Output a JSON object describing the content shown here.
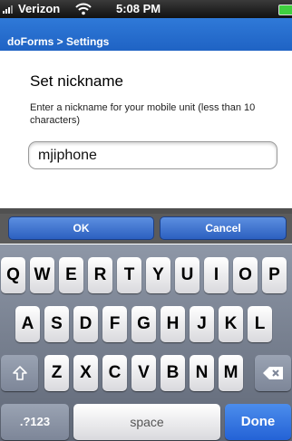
{
  "status_bar": {
    "carrier": "Verizon",
    "time": "5:08 PM"
  },
  "nav": {
    "title": "doForms > Settings"
  },
  "dialog": {
    "heading": "Set nickname",
    "description": "Enter a nickname for your mobile unit (less than 10 characters)",
    "nickname_value": "mjiphone"
  },
  "buttons": {
    "ok": "OK",
    "cancel": "Cancel"
  },
  "keyboard": {
    "row1": [
      "Q",
      "W",
      "E",
      "R",
      "T",
      "Y",
      "U",
      "I",
      "O",
      "P"
    ],
    "row2": [
      "A",
      "S",
      "D",
      "F",
      "G",
      "H",
      "J",
      "K",
      "L"
    ],
    "row3": [
      "Z",
      "X",
      "C",
      "V",
      "B",
      "N",
      "M"
    ],
    "numbers_key": ".?123",
    "space_key": "space",
    "done_key": "Done"
  },
  "colors": {
    "nav_blue": "#2670d0",
    "done_blue": "#2f6fe0",
    "keyboard_bg": "#7a8292"
  }
}
